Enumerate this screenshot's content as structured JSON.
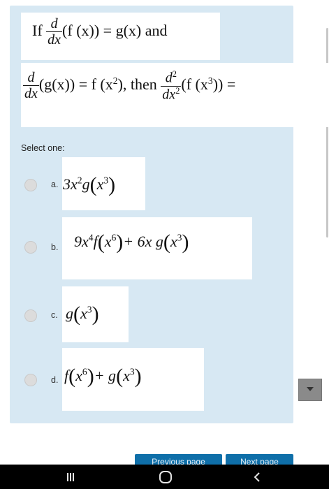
{
  "question": {
    "line1": {
      "prefix": "If",
      "d": "d",
      "dx": "dx",
      "expr": "(f (x)) = g(x)",
      "suffix": "and"
    },
    "line2": {
      "d": "d",
      "dx": "dx",
      "expr1": "(g(x)) = f (x",
      "exp1": "2",
      "expr1_end": "),",
      "then": "then",
      "d2_num": "d",
      "d2_num_exp": "2",
      "d2_den": "dx",
      "d2_den_exp": "2",
      "expr2": "(f (x",
      "exp2": "3",
      "expr2_end": ")) ="
    }
  },
  "select_label": "Select one:",
  "options": [
    {
      "letter": "a.",
      "coef": "3x",
      "coef_exp": "2",
      "func": "g",
      "arg": "x",
      "arg_exp": "3"
    },
    {
      "letter": "b.",
      "part1": "9x",
      "part1_exp": "4",
      "f": "f",
      "arg1": "x",
      "arg1_exp": "6",
      "plus": "+ 6x g",
      "arg2": "x",
      "arg2_exp": "3"
    },
    {
      "letter": "c.",
      "func": "g",
      "arg": "x",
      "arg_exp": "3"
    },
    {
      "letter": "d.",
      "f": "f",
      "arg1": "x",
      "arg1_exp": "6",
      "plus": "+ g",
      "arg2": "x",
      "arg2_exp": "3"
    }
  ],
  "nav": {
    "previous": "Previous page",
    "next": "Next page"
  },
  "colors": {
    "panel": "#d7e8f3",
    "nav_button": "#0f6fa9",
    "system_bar": "#000000"
  },
  "system_icons": [
    "recent-apps-icon",
    "home-icon",
    "back-icon"
  ]
}
